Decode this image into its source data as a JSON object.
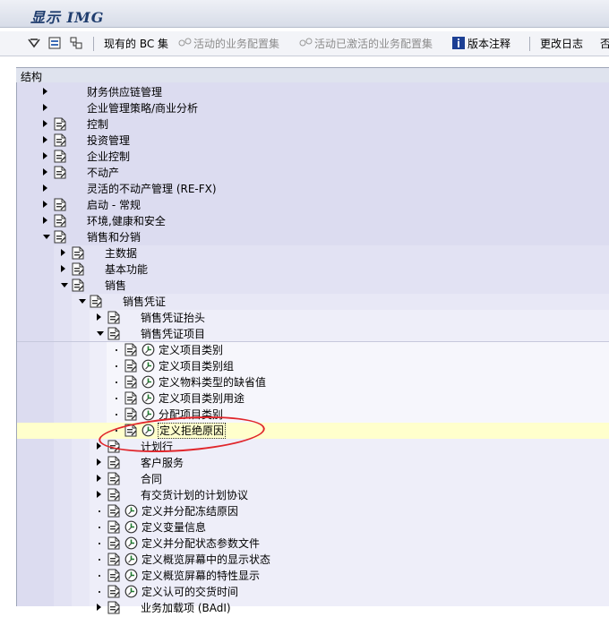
{
  "title": "显示 IMG",
  "toolbar": {
    "existing_bc_sets": "现有的 BC 集",
    "active_bc_sets": "活动的业务配置集",
    "activated_bc_sets": "活动已激活的业务配置集",
    "release_notes": "版本注释",
    "change_log": "更改日志",
    "overflow": "否"
  },
  "tree": {
    "header": "结构",
    "nodes": [
      "财务供应链管理",
      "企业管理策略/商业分析",
      "控制",
      "投资管理",
      "企业控制",
      "不动产",
      "灵活的不动产管理 (RE-FX)",
      "启动 - 常规",
      "环境,健康和安全",
      "销售和分销",
      "主数据",
      "基本功能",
      "销售",
      "销售凭证",
      "销售凭证抬头",
      "销售凭证项目",
      "定义项目类别",
      "定义项目类别组",
      "定义物料类型的缺省值",
      "定义项目类别用途",
      "分配项目类别",
      "定义拒绝原因",
      "计划行",
      "客户服务",
      "合同",
      "有交货计划的计划协议",
      "定义并分配冻结原因",
      "定义变量信息",
      "定义并分配状态参数文件",
      "定义概览屏幕中的显示状态",
      "定义概览屏幕的特性显示",
      "定义认可的交货时间",
      "业务加载项 (BAdI)"
    ]
  },
  "colors": {
    "tree_background": "#dcdcf0",
    "selected_row": "#ffffcc",
    "highlight_circle": "#e0262b"
  }
}
